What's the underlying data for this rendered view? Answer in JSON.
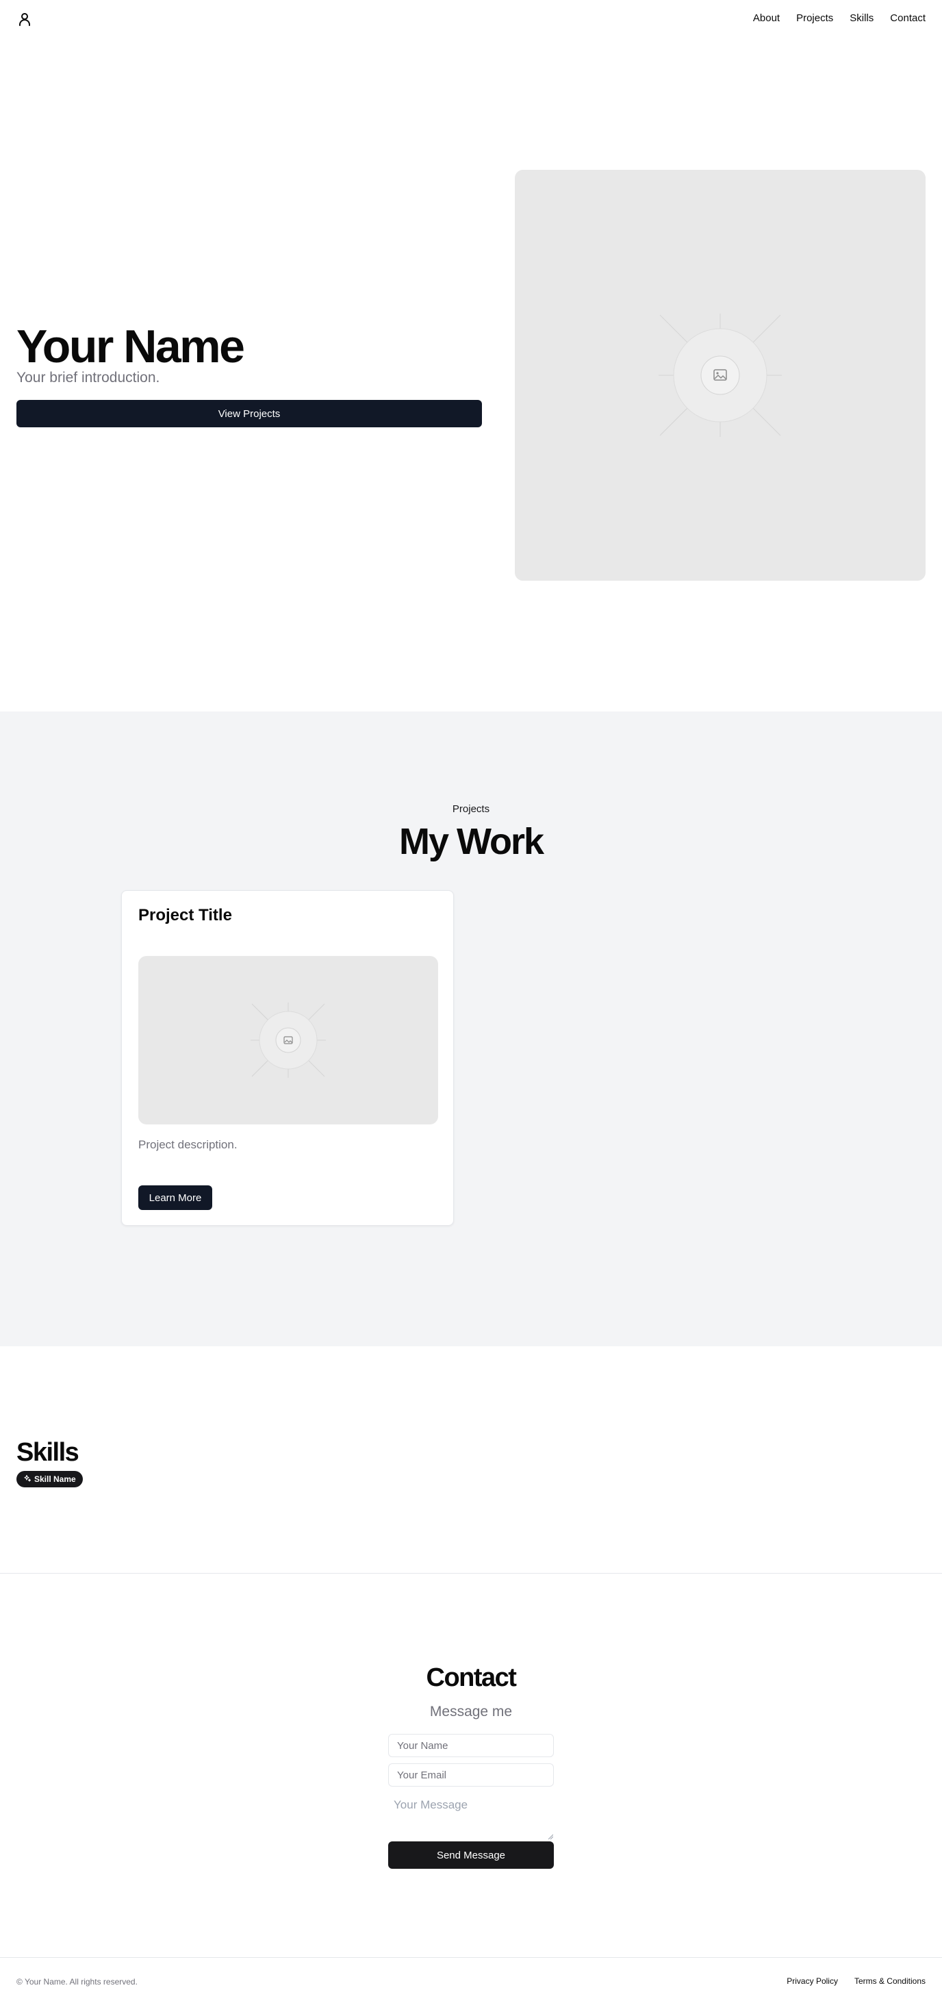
{
  "header": {
    "logo_icon": "user-icon",
    "nav": [
      "About",
      "Projects",
      "Skills",
      "Contact"
    ]
  },
  "hero": {
    "name": "Your Name",
    "intro": "Your brief introduction.",
    "cta_label": "View Projects",
    "image_icon": "image-placeholder-icon"
  },
  "projects": {
    "eyebrow": "Projects",
    "heading": "My Work",
    "cards": [
      {
        "title": "Project Title",
        "description": "Project description.",
        "button_label": "Learn More",
        "image_icon": "image-placeholder-icon"
      }
    ]
  },
  "skills": {
    "heading": "Skills",
    "badges": [
      {
        "label": "Skill Name",
        "icon": "sparkles-icon"
      }
    ]
  },
  "contact": {
    "heading": "Contact",
    "subheading": "Message me",
    "name_placeholder": "Your Name",
    "email_placeholder": "Your Email",
    "message_placeholder": "Your Message",
    "send_label": "Send Message"
  },
  "footer": {
    "copyright": "© Your Name. All rights reserved.",
    "links": [
      "Privacy Policy",
      "Terms & Conditions"
    ]
  },
  "colors": {
    "primary_button": "#111827",
    "send_button": "#18181b",
    "projects_bg": "#f3f4f6",
    "placeholder_bg": "#e8e8e8",
    "muted_text": "#71717a"
  }
}
